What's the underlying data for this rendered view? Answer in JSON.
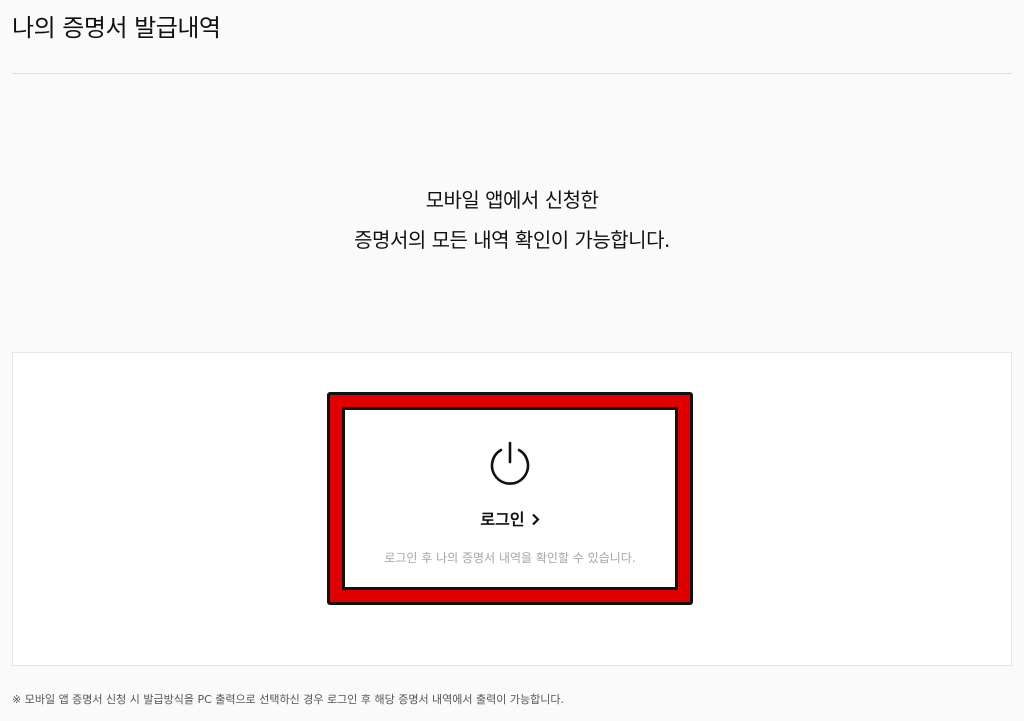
{
  "page": {
    "title": "나의 증명서 발급내역"
  },
  "intro": {
    "line1": "모바일 앱에서 신청한",
    "line2": "증명서의 모든 내역 확인이 가능합니다."
  },
  "login": {
    "icon": "power-icon",
    "link_label": "로그인",
    "description": "로그인 후 나의 증명서 내역을 확인할 수 있습니다."
  },
  "footnote": {
    "text": "※ 모바일 앱 증명서 신청 시 발급방식을 PC 출력으로 선택하신 경우 로그인 후 해당 증명서 내역에서 출력이 가능합니다."
  },
  "colors": {
    "highlight_frame": "#e00000",
    "background": "#fafafa",
    "panel": "#ffffff"
  }
}
